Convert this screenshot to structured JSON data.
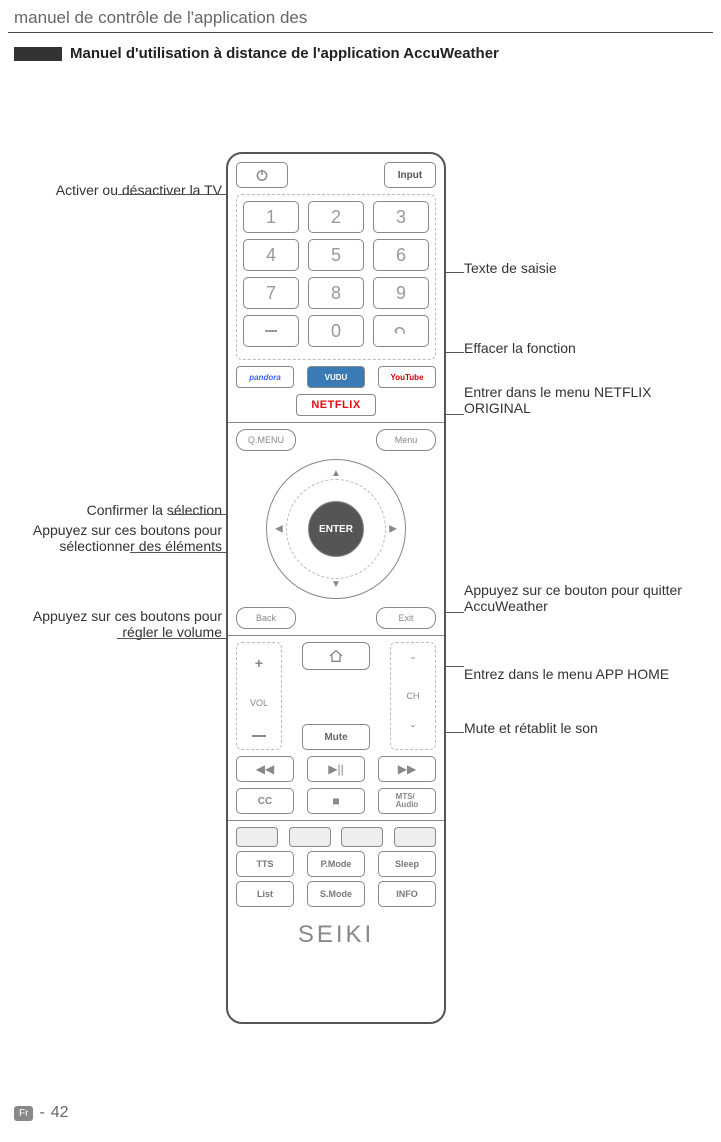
{
  "header": {
    "title": "manuel de contrôle de l'application des",
    "section_title": "Manuel d'utilisation à distance de l'application AccuWeather"
  },
  "remote": {
    "input": "Input",
    "numbers": [
      "1",
      "2",
      "3",
      "4",
      "5",
      "6",
      "7",
      "8",
      "9",
      "",
      "0",
      ""
    ],
    "apps": {
      "pandora": "pandora",
      "vudu": "VUDU",
      "youtube": "YouTube"
    },
    "netflix": "NETFLIX",
    "qmenu": "Q.MENU",
    "menu": "Menu",
    "enter": "ENTER",
    "back": "Back",
    "exit": "Exit",
    "vol": "VOL",
    "ch": "CH",
    "mute": "Mute",
    "cc": "CC",
    "mts": "MTS/\nAudio",
    "tts": "TTS",
    "pmode": "P.Mode",
    "sleep": "Sleep",
    "list": "List",
    "smode": "S.Mode",
    "info": "INFO",
    "brand": "SEIKI"
  },
  "callouts": {
    "power": "Activer ou désactiver la TV",
    "confirm": "Confirmer la sélection",
    "select": "Appuyez sur ces boutons pour sélectionner des éléments",
    "volume": "Appuyez sur ces boutons pour régler le volume",
    "text_input": "Texte de saisie",
    "clear": "Effacer la fonction",
    "netflix": "Entrer dans le menu NETFLIX ORIGINAL",
    "exit": "Appuyez sur ce bouton pour quitter AccuWeather",
    "home": "Entrez dans le menu APP HOME",
    "mute": "Mute et rétablit le son"
  },
  "footer": {
    "lang": "Fr",
    "page": "42"
  }
}
